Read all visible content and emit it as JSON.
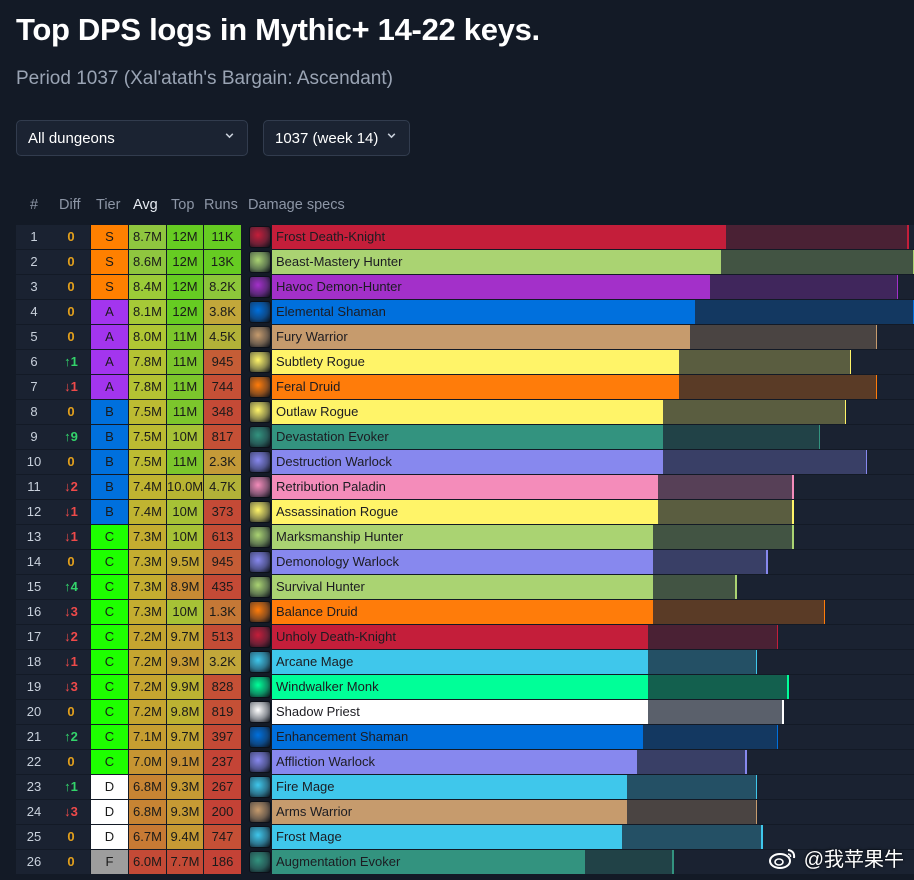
{
  "page": {
    "title": "Top DPS logs in Mythic+ 14-22 keys.",
    "subtitle": "Period 1037 (Xal'atath's Bargain: Ascendant)"
  },
  "filters": {
    "dungeon": "All dungeons",
    "week": "1037 (week 14)",
    "chevron": "⌄"
  },
  "columns": {
    "rank": "#",
    "diff": "Diff",
    "tier": "Tier",
    "avg": "Avg",
    "top": "Top",
    "runs": "Runs",
    "specs": "Damage specs"
  },
  "tier_colors": {
    "S": "#ff8000",
    "A": "#a335ee",
    "B": "#0070dd",
    "C": "#1eff00",
    "D": "#ffffff",
    "F": "#9d9d9d"
  },
  "diff_icons": {
    "up": "↑",
    "down": "↓"
  },
  "scale_max": 12.3,
  "rows": [
    {
      "rank": "1",
      "diff": "0",
      "tier": "S",
      "avg": "8.7M",
      "top": "12M",
      "runs": "11K",
      "spec": "Frost Death-Knight",
      "icon": "frost-death-knight-icon",
      "color": "#c41e3a",
      "avg_val": 8.7,
      "top_val": 12.2,
      "avg_bg": "#8fc63f",
      "top_bg": "#66cc22",
      "runs_bg": "#66cc22"
    },
    {
      "rank": "2",
      "diff": "0",
      "tier": "S",
      "avg": "8.6M",
      "top": "12M",
      "runs": "13K",
      "spec": "Beast-Mastery Hunter",
      "icon": "beast-mastery-hunter-icon",
      "color": "#aad372",
      "avg_val": 8.6,
      "top_val": 12.3,
      "avg_bg": "#8fc63f",
      "top_bg": "#66cc22",
      "runs_bg": "#66cc22"
    },
    {
      "rank": "3",
      "diff": "0",
      "tier": "S",
      "avg": "8.4M",
      "top": "12M",
      "runs": "8.2K",
      "spec": "Havoc Demon-Hunter",
      "icon": "havoc-demon-hunter-icon",
      "color": "#a330c9",
      "avg_val": 8.4,
      "top_val": 12.0,
      "avg_bg": "#9ccb38",
      "top_bg": "#66cc22",
      "runs_bg": "#8cc63a"
    },
    {
      "rank": "4",
      "diff": "0",
      "tier": "A",
      "avg": "8.1M",
      "top": "12M",
      "runs": "3.8K",
      "spec": "Elemental Shaman",
      "icon": "elemental-shaman-icon",
      "color": "#0070dd",
      "avg_val": 8.1,
      "top_val": 12.3,
      "avg_bg": "#a6c937",
      "top_bg": "#66cc22",
      "runs_bg": "#c2a73a"
    },
    {
      "rank": "5",
      "diff": "0",
      "tier": "A",
      "avg": "8.0M",
      "top": "11M",
      "runs": "4.5K",
      "spec": "Fury Warrior",
      "icon": "fury-warrior-icon",
      "color": "#c69b6d",
      "avg_val": 8.0,
      "top_val": 11.6,
      "avg_bg": "#b0c634",
      "top_bg": "#7cc62c",
      "runs_bg": "#b2b238"
    },
    {
      "rank": "6",
      "diff": "up",
      "diff_n": "1",
      "tier": "A",
      "avg": "7.8M",
      "top": "11M",
      "runs": "945",
      "spec": "Subtlety Rogue",
      "icon": "subtlety-rogue-icon",
      "color": "#fff468",
      "avg_val": 7.8,
      "top_val": 11.1,
      "avg_bg": "#b4c233",
      "top_bg": "#7cc62c",
      "runs_bg": "#c55d36"
    },
    {
      "rank": "7",
      "diff": "down",
      "diff_n": "1",
      "tier": "A",
      "avg": "7.8M",
      "top": "11M",
      "runs": "744",
      "spec": "Feral Druid",
      "icon": "feral-druid-icon",
      "color": "#ff7c0a",
      "avg_val": 7.8,
      "top_val": 11.6,
      "avg_bg": "#b4c233",
      "top_bg": "#7cc62c",
      "runs_bg": "#c55036"
    },
    {
      "rank": "8",
      "diff": "0",
      "tier": "B",
      "avg": "7.5M",
      "top": "11M",
      "runs": "348",
      "spec": "Outlaw Rogue",
      "icon": "outlaw-rogue-icon",
      "color": "#fff468",
      "avg_val": 7.5,
      "top_val": 11.0,
      "avg_bg": "#bcbb32",
      "top_bg": "#7cc62c",
      "runs_bg": "#c44a36"
    },
    {
      "rank": "9",
      "diff": "up",
      "diff_n": "9",
      "tier": "B",
      "avg": "7.5M",
      "top": "10M",
      "runs": "817",
      "spec": "Devastation Evoker",
      "icon": "devastation-evoker-icon",
      "color": "#33937f",
      "avg_val": 7.5,
      "top_val": 10.5,
      "avg_bg": "#bcbb32",
      "top_bg": "#a6c236",
      "runs_bg": "#c55036"
    },
    {
      "rank": "10",
      "diff": "0",
      "tier": "B",
      "avg": "7.5M",
      "top": "11M",
      "runs": "2.3K",
      "spec": "Destruction Warlock",
      "icon": "destruction-warlock-icon",
      "color": "#8788ee",
      "avg_val": 7.5,
      "top_val": 11.4,
      "avg_bg": "#bcbb32",
      "top_bg": "#7cc62c",
      "runs_bg": "#c49a38"
    },
    {
      "rank": "11",
      "diff": "down",
      "diff_n": "2",
      "tier": "B",
      "avg": "7.4M",
      "top": "10.0M",
      "runs": "4.7K",
      "spec": "Retribution Paladin",
      "icon": "retribution-paladin-icon",
      "color": "#f48cba",
      "avg_val": 7.4,
      "top_val": 10.0,
      "avg_bg": "#c0b431",
      "top_bg": "#b8b432",
      "runs_bg": "#b2b238"
    },
    {
      "rank": "12",
      "diff": "down",
      "diff_n": "1",
      "tier": "B",
      "avg": "7.4M",
      "top": "10M",
      "runs": "373",
      "spec": "Assassination Rogue",
      "icon": "assassination-rogue-icon",
      "color": "#fff468",
      "avg_val": 7.4,
      "top_val": 10.0,
      "avg_bg": "#c0b431",
      "top_bg": "#a6c236",
      "runs_bg": "#c44a36"
    },
    {
      "rank": "13",
      "diff": "down",
      "diff_n": "1",
      "tier": "C",
      "avg": "7.3M",
      "top": "10M",
      "runs": "613",
      "spec": "Marksmanship Hunter",
      "icon": "marksmanship-hunter-icon",
      "color": "#aad372",
      "avg_val": 7.3,
      "top_val": 10.0,
      "avg_bg": "#c4ad30",
      "top_bg": "#a6c236",
      "runs_bg": "#c44e36"
    },
    {
      "rank": "14",
      "diff": "0",
      "tier": "C",
      "avg": "7.3M",
      "top": "9.5M",
      "runs": "945",
      "spec": "Demonology Warlock",
      "icon": "demonology-warlock-icon",
      "color": "#8788ee",
      "avg_val": 7.3,
      "top_val": 9.5,
      "avg_bg": "#c4ad30",
      "top_bg": "#c4a633",
      "runs_bg": "#c55d36"
    },
    {
      "rank": "15",
      "diff": "up",
      "diff_n": "4",
      "tier": "C",
      "avg": "7.3M",
      "top": "8.9M",
      "runs": "435",
      "spec": "Survival Hunter",
      "icon": "survival-hunter-icon",
      "color": "#aad372",
      "avg_val": 7.3,
      "top_val": 8.9,
      "avg_bg": "#c4ad30",
      "top_bg": "#c78a34",
      "runs_bg": "#c44a36"
    },
    {
      "rank": "16",
      "diff": "down",
      "diff_n": "3",
      "tier": "C",
      "avg": "7.3M",
      "top": "10M",
      "runs": "1.3K",
      "spec": "Balance Druid",
      "icon": "balance-druid-icon",
      "color": "#ff7c0a",
      "avg_val": 7.3,
      "top_val": 10.6,
      "avg_bg": "#c4ad30",
      "top_bg": "#a6c236",
      "runs_bg": "#c57836"
    },
    {
      "rank": "17",
      "diff": "down",
      "diff_n": "2",
      "tier": "C",
      "avg": "7.2M",
      "top": "9.7M",
      "runs": "513",
      "spec": "Unholy Death-Knight",
      "icon": "unholy-death-knight-icon",
      "color": "#c41e3a",
      "avg_val": 7.2,
      "top_val": 9.7,
      "avg_bg": "#c5a530",
      "top_bg": "#c4a633",
      "runs_bg": "#c44c36"
    },
    {
      "rank": "18",
      "diff": "down",
      "diff_n": "1",
      "tier": "C",
      "avg": "7.2M",
      "top": "9.3M",
      "runs": "3.2K",
      "spec": "Arcane Mage",
      "icon": "arcane-mage-icon",
      "color": "#3fc7eb",
      "avg_val": 7.2,
      "top_val": 9.3,
      "avg_bg": "#c5a530",
      "top_bg": "#c69a34",
      "runs_bg": "#c2a73a"
    },
    {
      "rank": "19",
      "diff": "down",
      "diff_n": "3",
      "tier": "C",
      "avg": "7.2M",
      "top": "9.9M",
      "runs": "828",
      "spec": "Windwalker Monk",
      "icon": "windwalker-monk-icon",
      "color": "#00ff98",
      "avg_val": 7.2,
      "top_val": 9.9,
      "avg_bg": "#c5a530",
      "top_bg": "#bcb232",
      "runs_bg": "#c55036"
    },
    {
      "rank": "20",
      "diff": "0",
      "tier": "C",
      "avg": "7.2M",
      "top": "9.8M",
      "runs": "819",
      "spec": "Shadow Priest",
      "icon": "shadow-priest-icon",
      "color": "#ffffff",
      "avg_val": 7.2,
      "top_val": 9.8,
      "avg_bg": "#c5a530",
      "top_bg": "#bcb232",
      "runs_bg": "#c55036"
    },
    {
      "rank": "21",
      "diff": "up",
      "diff_n": "2",
      "tier": "C",
      "avg": "7.1M",
      "top": "9.7M",
      "runs": "397",
      "spec": "Enhancement Shaman",
      "icon": "enhancement-shaman-icon",
      "color": "#0070dd",
      "avg_val": 7.1,
      "top_val": 9.7,
      "avg_bg": "#c69e31",
      "top_bg": "#c4a633",
      "runs_bg": "#c44a36"
    },
    {
      "rank": "22",
      "diff": "0",
      "tier": "C",
      "avg": "7.0M",
      "top": "9.1M",
      "runs": "237",
      "spec": "Affliction Warlock",
      "icon": "affliction-warlock-icon",
      "color": "#8788ee",
      "avg_val": 7.0,
      "top_val": 9.1,
      "avg_bg": "#c79532",
      "top_bg": "#c69034",
      "runs_bg": "#c44436"
    },
    {
      "rank": "23",
      "diff": "up",
      "diff_n": "1",
      "tier": "D",
      "avg": "6.8M",
      "top": "9.3M",
      "runs": "267",
      "spec": "Fire Mage",
      "icon": "fire-mage-icon",
      "color": "#3fc7eb",
      "avg_val": 6.8,
      "top_val": 9.3,
      "avg_bg": "#c78433",
      "top_bg": "#c69a34",
      "runs_bg": "#c44436"
    },
    {
      "rank": "24",
      "diff": "down",
      "diff_n": "3",
      "tier": "D",
      "avg": "6.8M",
      "top": "9.3M",
      "runs": "200",
      "spec": "Arms Warrior",
      "icon": "arms-warrior-icon",
      "color": "#c69b6d",
      "avg_val": 6.8,
      "top_val": 9.3,
      "avg_bg": "#c78433",
      "top_bg": "#c69a34",
      "runs_bg": "#c44236"
    },
    {
      "rank": "25",
      "diff": "0",
      "tier": "D",
      "avg": "6.7M",
      "top": "9.4M",
      "runs": "747",
      "spec": "Frost Mage",
      "icon": "frost-mage-icon",
      "color": "#3fc7eb",
      "avg_val": 6.7,
      "top_val": 9.4,
      "avg_bg": "#c77a34",
      "top_bg": "#c69a34",
      "runs_bg": "#c55036"
    },
    {
      "rank": "26",
      "diff": "0",
      "tier": "F",
      "avg": "6.0M",
      "top": "7.7M",
      "runs": "186",
      "spec": "Augmentation Evoker",
      "icon": "augmentation-evoker-icon",
      "color": "#33937f",
      "avg_val": 6.0,
      "top_val": 7.7,
      "avg_bg": "#c44a36",
      "top_bg": "#c44a36",
      "runs_bg": "#c44236"
    }
  ],
  "watermark": "@我苹果牛"
}
